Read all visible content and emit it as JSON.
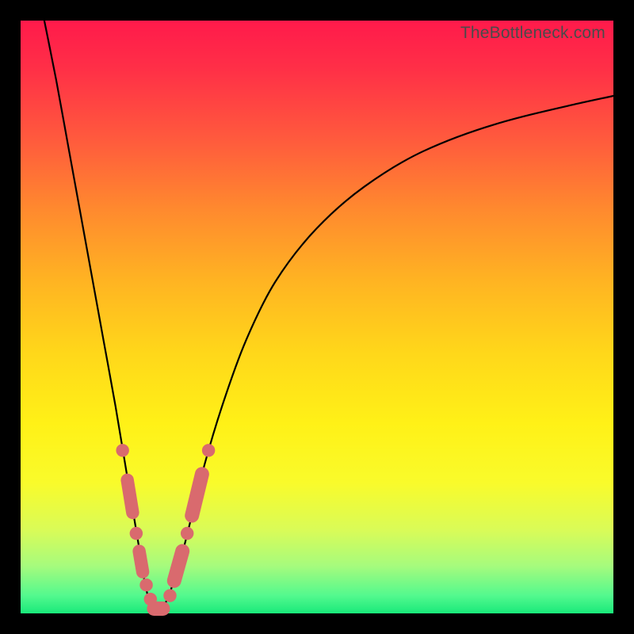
{
  "attribution": "TheBottleneck.com",
  "colors": {
    "bead": "#d96a6e",
    "curve": "#000000"
  },
  "chart_data": {
    "type": "line",
    "title": "",
    "xlabel": "",
    "ylabel": "",
    "xlim": [
      0,
      100
    ],
    "ylim": [
      0,
      100
    ],
    "grid": false,
    "legend": false,
    "series": [
      {
        "name": "bottleneck-curve",
        "x": [
          4,
          6,
          8,
          10,
          12,
          14,
          16,
          18,
          19,
          20,
          20.8,
          21.6,
          22.4,
          23,
          23.6,
          24.8,
          26,
          27.5,
          29,
          31,
          34,
          38,
          43,
          50,
          58,
          68,
          80,
          94,
          100
        ],
        "y": [
          100,
          90,
          79,
          68,
          57,
          46,
          35,
          23,
          17,
          11,
          6,
          2.5,
          0.5,
          0,
          0.5,
          2.5,
          6,
          11,
          17,
          25,
          35,
          46,
          56,
          65,
          72,
          78,
          82.5,
          86,
          87.3
        ]
      }
    ],
    "markers": [
      {
        "shape": "circle",
        "x": 17.2,
        "y": 27.5,
        "r": 1.1
      },
      {
        "shape": "capsule",
        "x1": 18.0,
        "y1": 22.5,
        "x2": 18.9,
        "y2": 17.0,
        "w": 2.2
      },
      {
        "shape": "circle",
        "x": 19.5,
        "y": 13.5,
        "r": 1.1
      },
      {
        "shape": "capsule",
        "x1": 20.0,
        "y1": 10.5,
        "x2": 20.6,
        "y2": 7.0,
        "w": 2.2
      },
      {
        "shape": "circle",
        "x": 21.2,
        "y": 4.8,
        "r": 1.1
      },
      {
        "shape": "circle",
        "x": 21.9,
        "y": 2.4,
        "r": 1.1
      },
      {
        "shape": "capsule",
        "x1": 22.5,
        "y1": 0.8,
        "x2": 24.0,
        "y2": 0.8,
        "w": 2.4
      },
      {
        "shape": "circle",
        "x": 25.2,
        "y": 3.0,
        "r": 1.1
      },
      {
        "shape": "capsule",
        "x1": 25.9,
        "y1": 5.5,
        "x2": 27.3,
        "y2": 10.5,
        "w": 2.4
      },
      {
        "shape": "circle",
        "x": 28.1,
        "y": 13.5,
        "r": 1.1
      },
      {
        "shape": "capsule",
        "x1": 28.9,
        "y1": 16.5,
        "x2": 30.6,
        "y2": 23.5,
        "w": 2.4
      },
      {
        "shape": "circle",
        "x": 31.7,
        "y": 27.5,
        "r": 1.1
      }
    ]
  }
}
